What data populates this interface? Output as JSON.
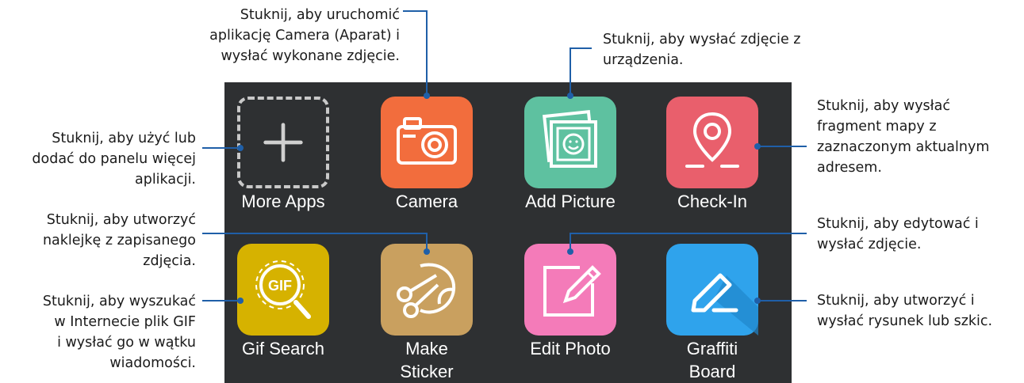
{
  "apps": [
    {
      "label": "More Apps",
      "color": "#2e3032",
      "icon": "plus-icon"
    },
    {
      "label": "Camera",
      "color": "#f26d3d",
      "icon": "camera-icon"
    },
    {
      "label": "Add Picture",
      "color": "#5ec1a0",
      "icon": "picture-icon"
    },
    {
      "label": "Check-In",
      "color": "#e95f6c",
      "icon": "location-pin-icon"
    },
    {
      "label": "Gif Search",
      "color": "#d6b200",
      "icon": "gif-search-icon"
    },
    {
      "label_lines": [
        "Make",
        "Sticker"
      ],
      "color": "#c9a05f",
      "icon": "scissors-icon"
    },
    {
      "label": "Edit Photo",
      "color": "#f47bb9",
      "icon": "edit-pencil-icon"
    },
    {
      "label_lines": [
        "Graffiti",
        "Board"
      ],
      "color": "#2fa3ec",
      "icon": "marker-icon"
    }
  ],
  "callouts": {
    "more_apps": [
      "Stuknij, aby użyć lub",
      "dodać do panelu więcej",
      "aplikacji."
    ],
    "camera": [
      "Stuknij, aby uruchomić",
      "aplikację Camera (Aparat) i",
      "wysłać wykonane zdjęcie."
    ],
    "add_picture": [
      "Stuknij, aby wysłać zdjęcie z",
      "urządzenia."
    ],
    "check_in": [
      "Stuknij, aby wysłać",
      "fragment mapy z",
      "zaznaczonym aktualnym",
      "adresem."
    ],
    "make_sticker": [
      "Stuknij, aby utworzyć",
      "naklejkę z zapisanego",
      "zdjęcia."
    ],
    "gif_search": [
      "Stuknij, aby wyszukać",
      "w Internecie plik GIF",
      "i wysłać go w wątku",
      "wiadomości."
    ],
    "edit_photo": [
      "Stuknij, aby edytować i",
      "wysłać zdjęcie."
    ],
    "graffiti": [
      "Stuknij, aby utworzyć i",
      "wysłać rysunek lub szkic."
    ]
  },
  "colors": {
    "panel": "#2e3032",
    "callout_line": "#1f5fa8"
  }
}
